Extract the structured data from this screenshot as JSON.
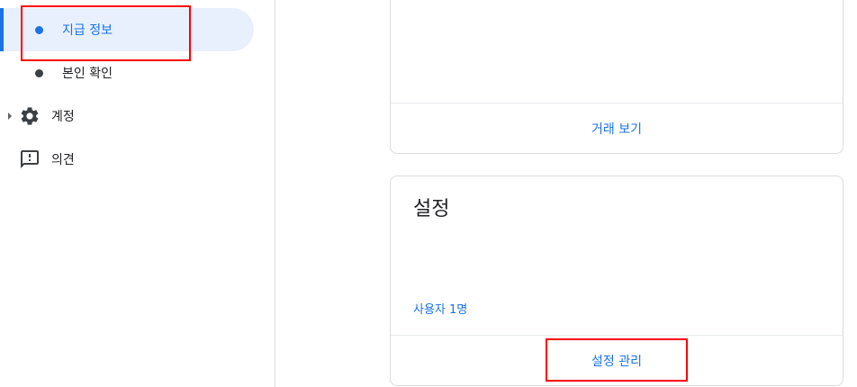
{
  "sidebar": {
    "items": [
      {
        "label": "지급 정보",
        "active": true,
        "icon": "dot-icon"
      },
      {
        "label": "본인 확인",
        "active": false,
        "icon": "dot-icon"
      },
      {
        "label": "계정",
        "active": false,
        "icon": "gear-icon",
        "expandable": true
      },
      {
        "label": "의견",
        "active": false,
        "icon": "feedback-icon"
      }
    ]
  },
  "cards": {
    "transactions": {
      "link_label": "거래 보기"
    },
    "settings": {
      "title": "설정",
      "users_text": "사용자 1명",
      "link_label": "설정 관리"
    }
  },
  "colors": {
    "accent": "#1a73e8",
    "active_bg": "#e8f0fe",
    "highlight": "#ff0000"
  }
}
